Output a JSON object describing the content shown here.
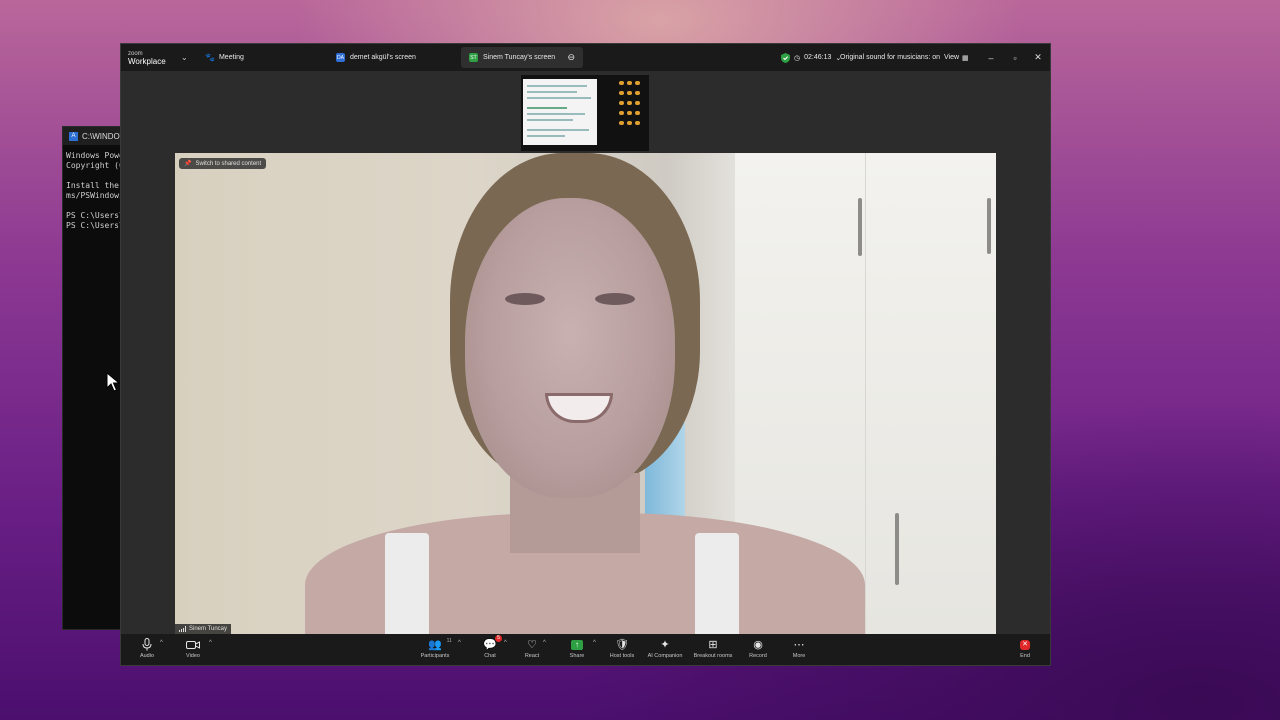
{
  "powershell": {
    "title": "C:\\WINDOW",
    "lines": [
      "Windows Powe",
      "Copyright (C",
      "",
      "Install the",
      "ms/PSWindows",
      "",
      "PS C:\\Users\\",
      "PS C:\\Users\\"
    ]
  },
  "zoom": {
    "brand_small": "zoom",
    "brand_big": "Workplace",
    "meeting_label": "Meeting",
    "tabs": [
      {
        "initials": "DA",
        "label": "demet akgül's screen",
        "color": "#2f6fd6"
      },
      {
        "initials": "ST",
        "label": "Sinem Tuncay's screen",
        "color": "#2ea043"
      }
    ],
    "timer": "02:46:13",
    "sound_label": "Original sound for musicians: on",
    "view_label": "View",
    "switch_label": "Switch to shared content",
    "participant_name": "Sinem Tuncay",
    "toolbar": {
      "audio": "Audio",
      "video": "Video",
      "participants": "Participants",
      "participants_count": "11",
      "chat": "Chat",
      "chat_badge": "5",
      "react": "React",
      "share": "Share",
      "host_tools": "Host tools",
      "ai_companion": "AI Companion",
      "breakout_rooms": "Breakout rooms",
      "record": "Record",
      "more": "More",
      "end": "End"
    },
    "icons": {
      "shield": "shield-icon",
      "mic": "microphone-icon",
      "camera": "camera-icon"
    },
    "colors": {
      "share_green": "#2ea043",
      "end_red": "#e02828",
      "shield_green": "#2ea043"
    }
  }
}
